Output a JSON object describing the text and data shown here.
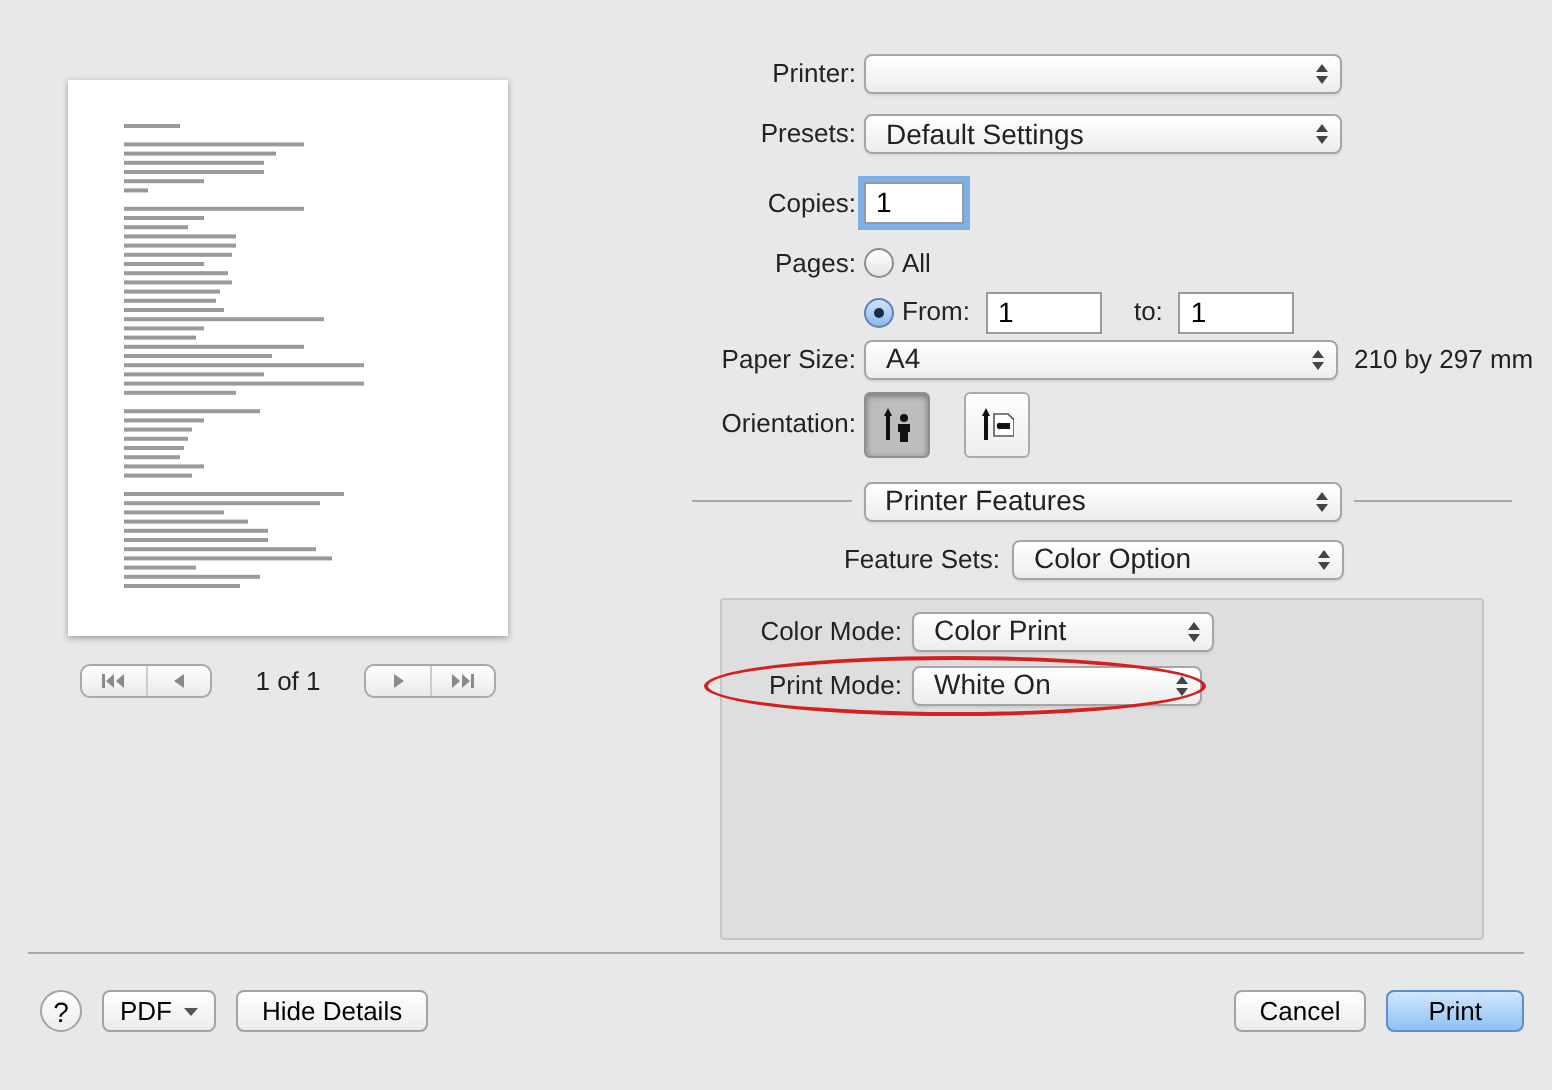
{
  "preview": {
    "page_label": "1 of 1"
  },
  "printer": {
    "label": "Printer:"
  },
  "presets": {
    "label": "Presets:",
    "value": "Default Settings"
  },
  "copies": {
    "label": "Copies:",
    "value": "1"
  },
  "pages": {
    "label": "Pages:",
    "options": [
      {
        "label": "All",
        "selected": false
      },
      {
        "label": "From:",
        "selected": true
      }
    ],
    "from": "1",
    "to_label": "to:",
    "to": "1"
  },
  "paper_size": {
    "label": "Paper Size:",
    "value": "A4",
    "dimensions": "210 by 297 mm"
  },
  "orientation": {
    "label": "Orientation:",
    "options": [
      {
        "kind": "portrait",
        "selected": true
      },
      {
        "kind": "landscape",
        "selected": false
      }
    ]
  },
  "section": {
    "value": "Printer Features"
  },
  "feature_sets": {
    "label": "Feature Sets:",
    "value": "Color Option"
  },
  "options": [
    {
      "label": "Color Mode:",
      "value": "Color Print",
      "highlighted": false
    },
    {
      "label": "Print Mode:",
      "value": "White On",
      "highlighted": true
    }
  ],
  "buttons": [
    {
      "kind": "help",
      "label": "?"
    },
    {
      "kind": "menu",
      "label": "PDF"
    },
    {
      "kind": "plain",
      "label": "Hide Details"
    },
    {
      "kind": "plain",
      "label": "Cancel"
    },
    {
      "kind": "default",
      "label": "Print"
    }
  ]
}
